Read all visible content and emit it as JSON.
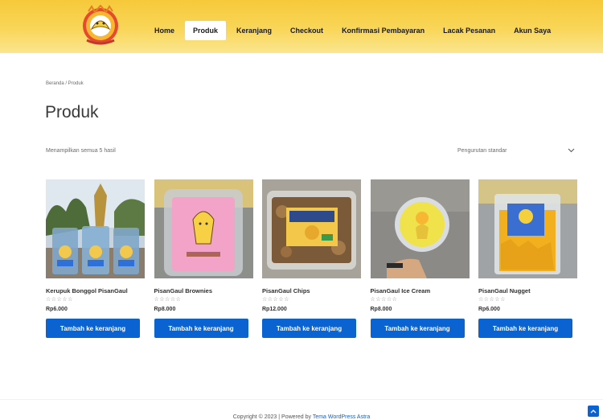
{
  "header": {
    "nav": [
      {
        "label": "Home",
        "active": false
      },
      {
        "label": "Produk",
        "active": true
      },
      {
        "label": "Keranjang",
        "active": false
      },
      {
        "label": "Checkout",
        "active": false
      },
      {
        "label": "Konfirmasi Pembayaran",
        "active": false
      },
      {
        "label": "Lacak Pesanan",
        "active": false
      },
      {
        "label": "Akun Saya",
        "active": false
      }
    ],
    "accent_color": "#f7cd45"
  },
  "breadcrumb": "Beranda / Produk",
  "page_title": "Produk",
  "result_count": "Menampilkan semua 5 hasil",
  "sort": {
    "selected": "Pengurutan standar",
    "icon": "chevron-down-icon"
  },
  "products": [
    {
      "name": "Kerupuk Bonggol PisanGaul",
      "rating": "☆☆☆☆☆",
      "price": "Rp6.000",
      "button": "Tambah ke keranjang"
    },
    {
      "name": "PisanGaul Brownies",
      "rating": "☆☆☆☆☆",
      "price": "Rp8.000",
      "button": "Tambah ke keranjang"
    },
    {
      "name": "PisanGaul Chips",
      "rating": "☆☆☆☆☆",
      "price": "Rp12.000",
      "button": "Tambah ke keranjang"
    },
    {
      "name": "PisanGaul Ice Cream",
      "rating": "☆☆☆☆☆",
      "price": "Rp8.000",
      "button": "Tambah ke keranjang"
    },
    {
      "name": "PisanGaul Nugget",
      "rating": "☆☆☆☆☆",
      "price": "Rp6.000",
      "button": "Tambah ke keranjang"
    }
  ],
  "footer": {
    "copyright_prefix": "Copyright © 2023 | Powered by ",
    "copyright_link": "Tema WordPress Astra"
  },
  "colors": {
    "button": "#0a63d1",
    "header_gradient_top": "#f6c93a",
    "header_gradient_bottom": "#fbe58f"
  }
}
